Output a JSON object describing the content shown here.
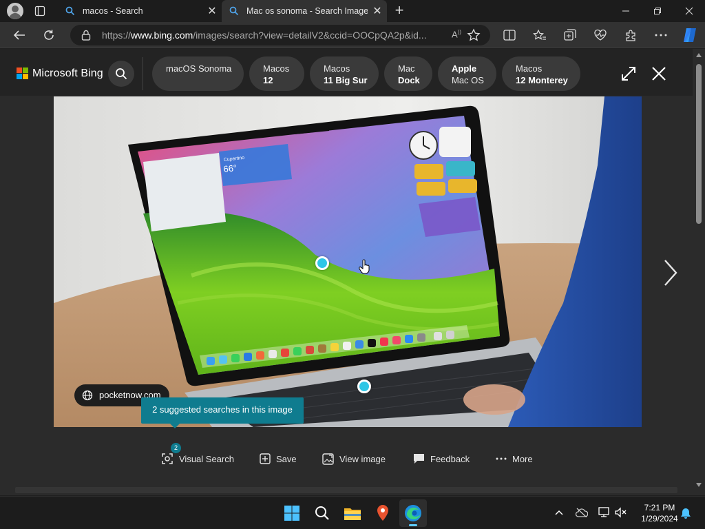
{
  "browser": {
    "tabs": [
      {
        "title": "macos - Search",
        "active": false
      },
      {
        "title": "Mac os sonoma - Search Images",
        "active": true
      }
    ],
    "address": {
      "prefix": "https://",
      "domain": "www.bing.com",
      "path": "/images/search?view=detailV2&ccid=OOCpQA2p&id..."
    }
  },
  "bing": {
    "brand": "Microsoft Bing",
    "related_searches": [
      {
        "line1": "macOS Sonoma",
        "line2": ""
      },
      {
        "line1": "Macos",
        "line2": "12"
      },
      {
        "line1": "Macos",
        "line2": "11 Big Sur"
      },
      {
        "line1": "Mac",
        "line2": "Dock"
      },
      {
        "line1": "Apple",
        "line2": "Mac OS"
      },
      {
        "line1": "Macos",
        "line2": "12 Monterey"
      }
    ],
    "source": "pocketnow.com",
    "tooltip": "2 suggested searches in this image",
    "visual_search_count": "2",
    "actions": {
      "visual_search": "Visual Search",
      "save": "Save",
      "view_image": "View image",
      "feedback": "Feedback",
      "more": "More"
    },
    "weather_widget": {
      "city": "Cupertino",
      "temp": "66°"
    }
  },
  "taskbar": {
    "time": "7:21 PM",
    "date": "1/29/2024"
  },
  "colors": {
    "accent_teal": "#0f7c8f",
    "hotspot": "#2ec6e6",
    "edge_indicator": "#60cdff"
  }
}
